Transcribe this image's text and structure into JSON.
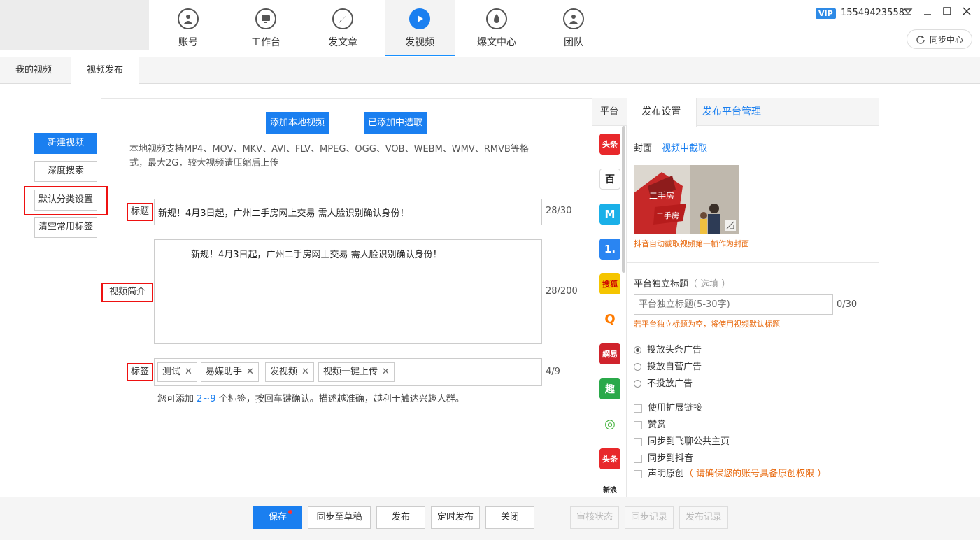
{
  "nav": {
    "tabs": [
      {
        "label": "账号",
        "icon": "user-icon"
      },
      {
        "label": "工作台",
        "icon": "monitor-icon"
      },
      {
        "label": "发文章",
        "icon": "feather-icon"
      },
      {
        "label": "发视频",
        "icon": "play-icon"
      },
      {
        "label": "爆文中心",
        "icon": "flame-icon"
      },
      {
        "label": "团队",
        "icon": "team-icon"
      }
    ],
    "active": "发视频"
  },
  "account": {
    "vip_badge": "VIP",
    "phone": "15549423558"
  },
  "sync_center": "同步中心",
  "subtabs": [
    "我的视频",
    "视频发布"
  ],
  "sidebar": {
    "new_video": "新建视频",
    "deep_search": "深度搜索",
    "default_category": "默认分类设置",
    "clear_tags": "清空常用标签"
  },
  "upload": {
    "add_local": "添加本地视频",
    "pick_added": "已添加中选取",
    "hint_line1": "本地视频支持MP4、MOV、MKV、AVI、FLV、MPEG、OGG、VOB、WEBM、WMV、RMVB等格",
    "hint_line2": "式，最大2G，较大视频请压缩后上传"
  },
  "form": {
    "title_label": "标题",
    "title_value": "新规！4月3日起，广州二手房网上交易 需人脸识别确认身份！",
    "title_count": "28/30",
    "desc_label": "视频简介",
    "desc_value": "新规！4月3日起，广州二手房网上交易 需人脸识别确认身份！",
    "desc_count": "28/200",
    "tags_label": "标签",
    "tags": [
      "测试",
      "易媒助手",
      "发视频",
      "视频一键上传"
    ],
    "tags_count": "4/9",
    "tags_hint_pre": "您可添加",
    "tags_hint_range": "2~9",
    "tags_hint_post": "个标签，按回车键确认。描述越准确，越利于触达兴趣人群。"
  },
  "platforms": {
    "header": "平台",
    "items": [
      {
        "label": "头条",
        "icon": "toutiao-icon",
        "color": "#e8282b"
      },
      {
        "label": "百",
        "icon": "baijia-icon",
        "color": "#ffffff"
      },
      {
        "label": "M",
        "icon": "dayu-icon",
        "color": "#1ab0e8"
      },
      {
        "label": "1.",
        "icon": "yidian-icon",
        "color": "#2a85f2"
      },
      {
        "label": "搜狐",
        "icon": "sohu-icon",
        "color": "#f5c500"
      },
      {
        "label": "Q",
        "icon": "qiehao-icon",
        "color": "#ff7b00"
      },
      {
        "label": "網易",
        "icon": "netease-icon",
        "color": "#d0232c"
      },
      {
        "label": "趣",
        "icon": "qutoutiao-icon",
        "color": "#2aa94a"
      },
      {
        "label": "◎",
        "icon": "aiqiyi-icon",
        "color": "#ffffff"
      },
      {
        "label": "头条",
        "icon": "xigua-icon",
        "color": "#e8282b"
      },
      {
        "label": "新浪",
        "icon": "sina-icon",
        "color": "#ffffff"
      }
    ]
  },
  "settings": {
    "tabs": [
      "发布设置",
      "发布平台管理"
    ],
    "cover_label": "封面",
    "cover_link": "视频中截取",
    "cover_note": "抖音自动截取视频第一帧作为封面",
    "indep_title_label": "平台独立标题",
    "indep_title_optional": "（ 选填 ）",
    "indep_title_placeholder": "平台独立标题(5-30字)",
    "indep_title_count": "0/30",
    "indep_title_note": "若平台独立标题为空，将使用视频默认标题",
    "ad_options": [
      {
        "label": "投放头条广告",
        "selected": true
      },
      {
        "label": "投放自营广告",
        "selected": false
      },
      {
        "label": "不投放广告",
        "selected": false
      }
    ],
    "checks": [
      {
        "label": "使用扩展链接",
        "checked": false
      },
      {
        "label": "赞赏",
        "checked": false
      },
      {
        "label": "同步到飞聊公共主页",
        "checked": false
      },
      {
        "label": "同步到抖音",
        "checked": false
      }
    ],
    "original_label": "声明原创",
    "original_note": "（ 请确保您的账号具备原创权限 ）"
  },
  "bottom": {
    "save": "保存",
    "sync_draft": "同步至草稿",
    "publish": "发布",
    "schedule": "定时发布",
    "close": "关闭",
    "review_status": "审核状态",
    "sync_record": "同步记录",
    "publish_record": "发布记录"
  },
  "colors": {
    "accent": "#1a7ff0",
    "warning": "#e8680c",
    "highlight_box": "#e11111"
  }
}
